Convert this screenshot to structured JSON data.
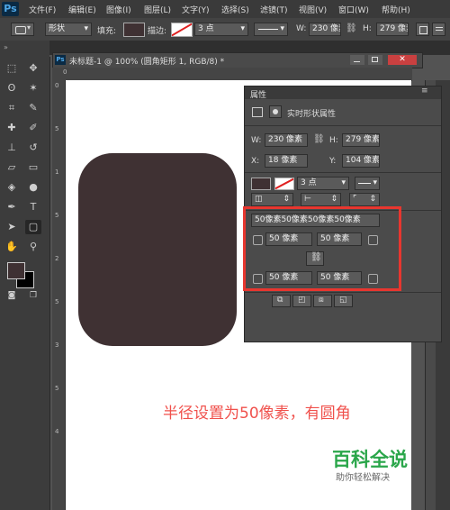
{
  "menu": {
    "logo": "Ps",
    "items": [
      "文件(F)",
      "编辑(E)",
      "图像(I)",
      "图层(L)",
      "文字(Y)",
      "选择(S)",
      "滤镜(T)",
      "视图(V)",
      "窗口(W)",
      "帮助(H)"
    ]
  },
  "options": {
    "mode": "形状",
    "fill_label": "填充:",
    "stroke_label": "描边:",
    "stroke_size": "3 点",
    "w_label": "W:",
    "w_value": "230 像素",
    "h_label": "H:",
    "h_value": "279 像素"
  },
  "document": {
    "icon": "Ps",
    "tab_title": "未标题-1 @ 100% (圆角矩形 1, RGB/8) *"
  },
  "ruler": {
    "h_ticks": [
      "0"
    ],
    "v_ticks": [
      "0",
      "5",
      "1",
      "5",
      "2",
      "5",
      "3",
      "5",
      "4"
    ]
  },
  "colors": {
    "shape_fill": "#3f3133",
    "annotation": "#f0514c",
    "red_frame": "#e8362f",
    "watermark": "#2aa64a"
  },
  "properties_panel": {
    "title": "属性",
    "section_title": "实时形状属性",
    "w_label": "W:",
    "w_value": "230 像素",
    "h_label": "H:",
    "h_value": "279 像素",
    "x_label": "X:",
    "x_value": "18 像素",
    "y_label": "Y:",
    "y_value": "104 像素",
    "stroke_size": "3 点",
    "radii_summary": "50像素50像素50像素50像素",
    "top_left_radius": "50 像素",
    "top_right_radius": "50 像素",
    "bottom_left_radius": "50 像素",
    "bottom_right_radius": "50 像素"
  },
  "annotation": {
    "text": "半径设置为50像素，有圆角"
  },
  "watermark": {
    "title": "百科全说",
    "subtitle": "助你轻松解决"
  }
}
